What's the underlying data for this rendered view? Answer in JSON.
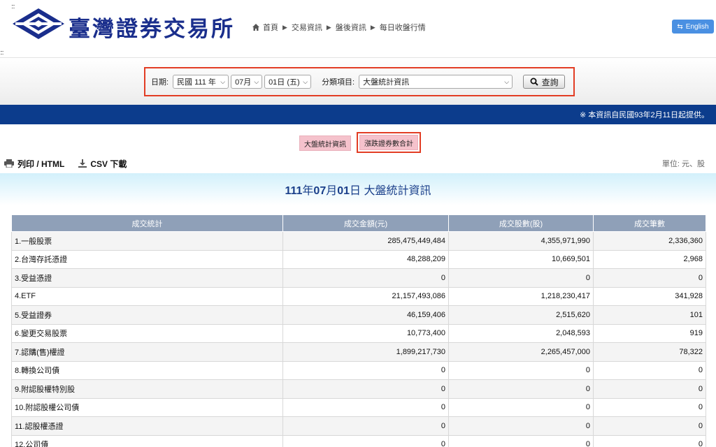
{
  "header": {
    "logo_text": "臺灣證券交易所",
    "breadcrumb": [
      "首頁",
      "交易資訊",
      "盤後資訊",
      "每日收盤行情"
    ],
    "english_label": "English"
  },
  "search": {
    "date_label": "日期:",
    "year_value": "民國 111 年",
    "month_value": "07月",
    "day_value": "01日 (五)",
    "category_label": "分類項目:",
    "category_value": "大盤統計資訊",
    "query_label": "查詢"
  },
  "notice": "※ 本資訊自民國93年2月11日起提供。",
  "tabs": [
    "大盤統計資訊",
    "漲跌證券數合計"
  ],
  "toolbar": {
    "print_label": "列印 / HTML",
    "csv_label": "CSV 下載",
    "unit_label": "單位: 元、股"
  },
  "title": {
    "year": "111",
    "y_suffix": "年",
    "month": "07",
    "m_suffix": "月",
    "day": "01",
    "d_suffix": "日",
    "name": "大盤統計資訊"
  },
  "table": {
    "headers": [
      "成交統計",
      "成交金額(元)",
      "成交股數(股)",
      "成交筆數"
    ],
    "rows": [
      [
        "1.一般股票",
        "285,475,449,484",
        "4,355,971,990",
        "2,336,360"
      ],
      [
        "2.台灣存託憑證",
        "48,288,209",
        "10,669,501",
        "2,968"
      ],
      [
        "3.受益憑證",
        "0",
        "0",
        "0"
      ],
      [
        "4.ETF",
        "21,157,493,086",
        "1,218,230,417",
        "341,928"
      ],
      [
        "5.受益證券",
        "46,159,406",
        "2,515,620",
        "101"
      ],
      [
        "6.變更交易股票",
        "10,773,400",
        "2,048,593",
        "919"
      ],
      [
        "7.認購(售)權證",
        "1,899,217,730",
        "2,265,457,000",
        "78,322"
      ],
      [
        "8.轉換公司債",
        "0",
        "0",
        "0"
      ],
      [
        "9.附認股權特別股",
        "0",
        "0",
        "0"
      ],
      [
        "10.附認股權公司債",
        "0",
        "0",
        "0"
      ],
      [
        "11.認股權憑證",
        "0",
        "0",
        "0"
      ],
      [
        "12.公司債",
        "0",
        "0",
        "0"
      ]
    ]
  },
  "colors": {
    "brand_blue": "#1a2e8c",
    "band_blue": "#0c3c8c",
    "highlight_red": "#e23d24",
    "tab_pink": "#f5c2cc",
    "header_gray": "#8fa0b8"
  },
  "icons": [
    "home-icon",
    "chevron-right-icon",
    "swap-icon",
    "chevron-down-icon",
    "search-icon",
    "printer-icon",
    "download-icon"
  ]
}
